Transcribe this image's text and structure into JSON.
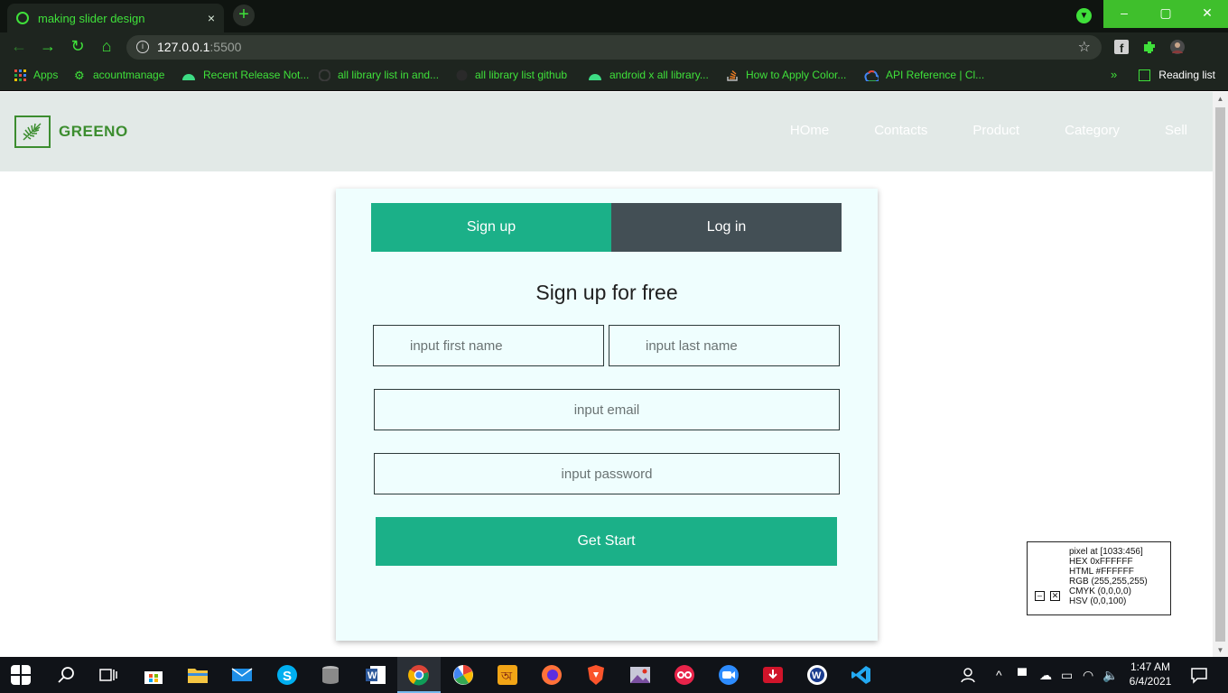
{
  "browser": {
    "tab_title": "making slider design",
    "tab_close": "×",
    "new_tab": "+",
    "url_host": "127.0.0.1",
    "url_port": ":5500",
    "window_buttons": [
      "–",
      "▢",
      "✕"
    ],
    "reading_list": "Reading list",
    "bookmarks": [
      "Apps",
      "acountmanage",
      "Recent Release Not...",
      "all library list in and...",
      "all library list github",
      "android x all library...",
      "How to Apply Color...",
      "API Reference  |  Cl..."
    ],
    "accent": "#3fe03a"
  },
  "site": {
    "logo_text": "GREENO",
    "nav": [
      "HOme",
      "Contacts",
      "Product",
      "Category",
      "Sell"
    ]
  },
  "form": {
    "tab_signup": "Sign up",
    "tab_login": "Log in",
    "heading": "Sign up for free",
    "first_name_placeholder": "input first name",
    "last_name_placeholder": "input last name",
    "email_placeholder": "input email",
    "password_placeholder": "input password",
    "submit_label": "Get Start",
    "primary_color": "#1bb088",
    "secondary_color": "#434f55"
  },
  "color_picker": {
    "lines": [
      "pixel at [1033:456]",
      "HEX 0xFFFFFF",
      "HTML #FFFFFF",
      "RGB (255,255,255)",
      "CMYK (0,0,0,0)",
      "HSV (0,0,100)"
    ],
    "minimize": "–",
    "close": "✕"
  },
  "taskbar": {
    "time": "1:47 AM",
    "date": "6/4/2021"
  }
}
